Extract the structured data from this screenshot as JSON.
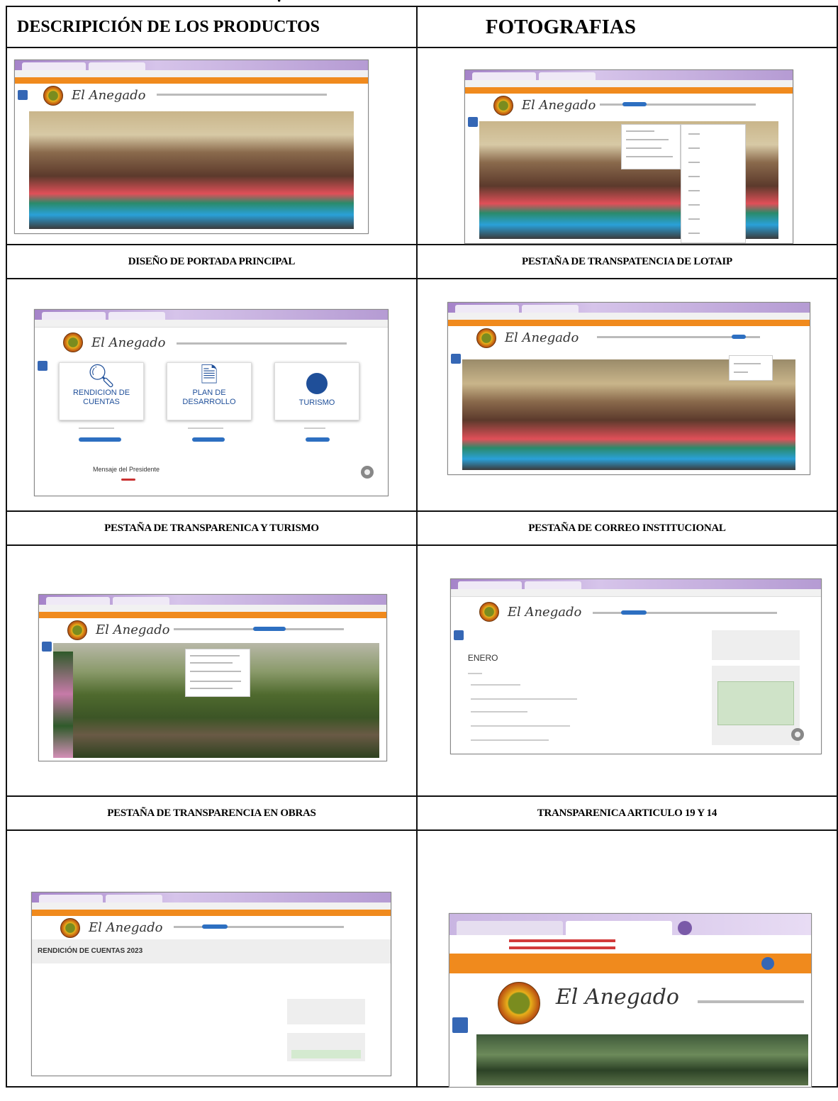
{
  "header_left": "DESCRIPICIÓN DE LOS PRODUCTOS",
  "header_right": "FOTOGRAFIAS",
  "rows": [
    {
      "left": "DISEÑO DE PORTADA PRINCIPAL",
      "right": "PESTAÑA DE TRANSPATENCIA DE LOTAIP"
    },
    {
      "left": "PESTAÑA DE TRANSPARENICA Y TURISMO",
      "right": "PESTAÑA DE CORREO INSTITUCIONAL"
    },
    {
      "left": "PESTAÑA DE TRANSPARENCIA EN OBRAS",
      "right": "TRANSPARENICA ARTICULO 19 Y 14"
    }
  ],
  "site": {
    "brand": "El Anegado",
    "card_rendicion": "RENDICION DE CUENTAS",
    "card_plan": "PLAN DE DESARROLLO",
    "card_turismo": "TURISMO",
    "month": "ENERO",
    "rendicion_title": "RENDICIÓN DE CUENTAS 2023",
    "mensaje": "Mensaje del Presidente"
  },
  "colors": {
    "orange": "#f08a1d",
    "purple": "#a583c9",
    "blue": "#3567b5"
  }
}
